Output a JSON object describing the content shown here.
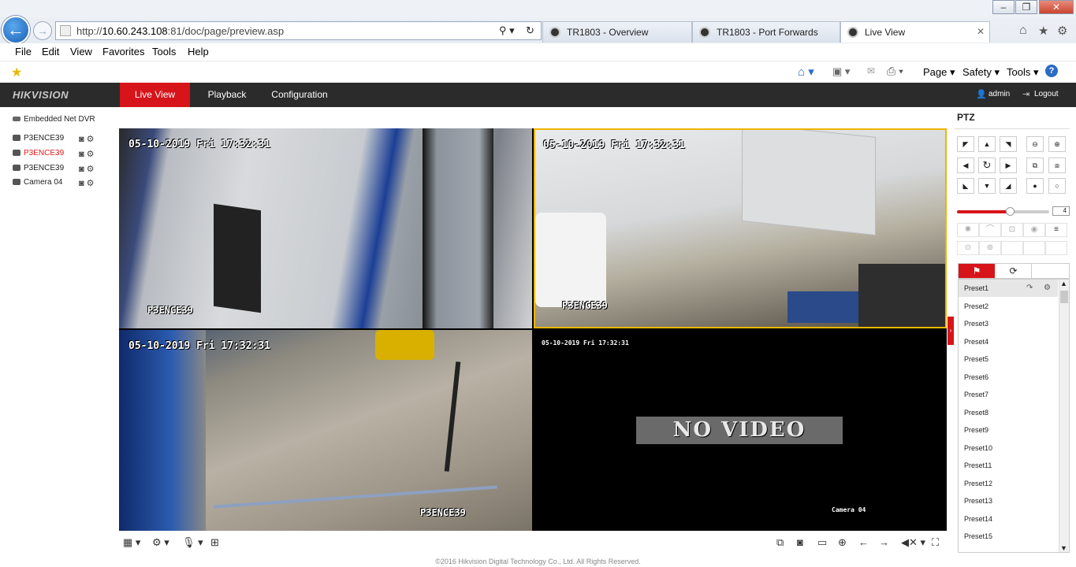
{
  "browser": {
    "address": {
      "prefix": "http://",
      "host": "10.60.243.108",
      "rest": ":81/doc/page/preview.asp"
    },
    "tabs": [
      {
        "label": "TR1803 - Overview",
        "active": false
      },
      {
        "label": "TR1803 - Port Forwards",
        "active": false
      },
      {
        "label": "Live View",
        "active": true
      }
    ],
    "menu": [
      "File",
      "Edit",
      "View",
      "Favorites",
      "Tools",
      "Help"
    ],
    "commands": {
      "page": "Page ▾",
      "safety": "Safety ▾",
      "tools": "Tools ▾"
    }
  },
  "header": {
    "logo": "HIKVISION",
    "nav": [
      "Live View",
      "Playback",
      "Configuration"
    ],
    "active_nav": "Live View",
    "user": "admin",
    "logout": "Logout"
  },
  "tree": {
    "root": "Embedded Net DVR",
    "cameras": [
      {
        "label": "P3ENCE39",
        "color": "#222222"
      },
      {
        "label": "P3ENCE39",
        "color": "#e01b1b"
      },
      {
        "label": "P3ENCE39",
        "color": "#222222"
      },
      {
        "label": "Camera 04",
        "color": "#222222"
      }
    ]
  },
  "video": {
    "timestamp": "05-10-2019 Fri 17:32:31",
    "cells": [
      {
        "name": "P3ENCE39"
      },
      {
        "name": "P3ENCE39"
      },
      {
        "name": "P3ENCE39"
      },
      {
        "name": "Camera 04"
      }
    ],
    "no_video": "NO VIDEO",
    "selected_cell_color": "#f0b400"
  },
  "ptz": {
    "title": "PTZ",
    "speed": 4,
    "speed_max": 7,
    "presets": [
      "Preset1",
      "Preset2",
      "Preset3",
      "Preset4",
      "Preset5",
      "Preset6",
      "Preset7",
      "Preset8",
      "Preset9",
      "Preset10",
      "Preset11",
      "Preset12",
      "Preset13",
      "Preset14",
      "Preset15"
    ]
  },
  "footer": "©2016 Hikvision Digital Technology Co., Ltd. All Rights Reserved.",
  "colors": {
    "accent": "#d7141a",
    "header_bg": "#2b2b2b"
  }
}
